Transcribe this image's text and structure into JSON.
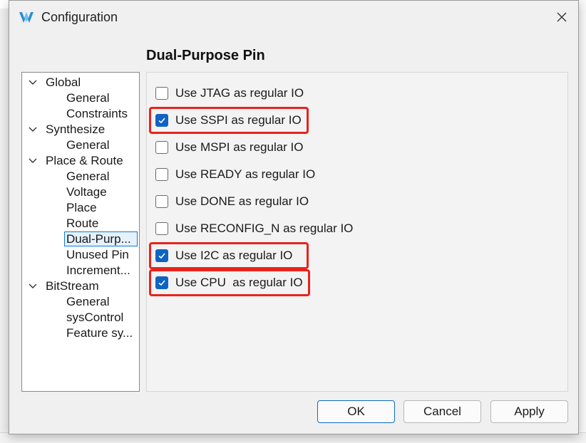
{
  "window": {
    "title": "Configuration"
  },
  "tree": {
    "groups": [
      {
        "label": "Global",
        "children": [
          "General",
          "Constraints"
        ]
      },
      {
        "label": "Synthesize",
        "children": [
          "General"
        ]
      },
      {
        "label": "Place & Route",
        "children": [
          "General",
          "Voltage",
          "Place",
          "Route",
          "Dual-Purp...",
          "Unused Pin",
          "Increment..."
        ]
      },
      {
        "label": "BitStream",
        "children": [
          "General",
          "sysControl",
          "Feature sy..."
        ]
      }
    ],
    "selected": "Dual-Purp..."
  },
  "section": {
    "title": "Dual-Purpose Pin"
  },
  "options": [
    {
      "label": "Use JTAG as regular IO",
      "checked": false,
      "highlighted": false
    },
    {
      "label": "Use SSPI as regular IO",
      "checked": true,
      "highlighted": true
    },
    {
      "label": "Use MSPI as regular IO",
      "checked": false,
      "highlighted": false
    },
    {
      "label": "Use READY as regular IO",
      "checked": false,
      "highlighted": false
    },
    {
      "label": "Use DONE as regular IO",
      "checked": false,
      "highlighted": false
    },
    {
      "label": "Use RECONFIG_N as regular IO",
      "checked": false,
      "highlighted": false
    },
    {
      "label": "Use I2C as regular IO",
      "checked": true,
      "highlighted": true
    },
    {
      "label": "Use CPU  as regular IO",
      "checked": true,
      "highlighted": true
    }
  ],
  "buttons": {
    "ok": "OK",
    "cancel": "Cancel",
    "apply": "Apply"
  },
  "colors": {
    "checkbox_checked": "#0f64c3",
    "highlight": "#e8231d",
    "selection": "#0f7bd1"
  },
  "icons": {
    "app": "gowin-logo-icon",
    "close": "close-icon",
    "expand": "chevron-down-icon",
    "check": "check-icon"
  }
}
